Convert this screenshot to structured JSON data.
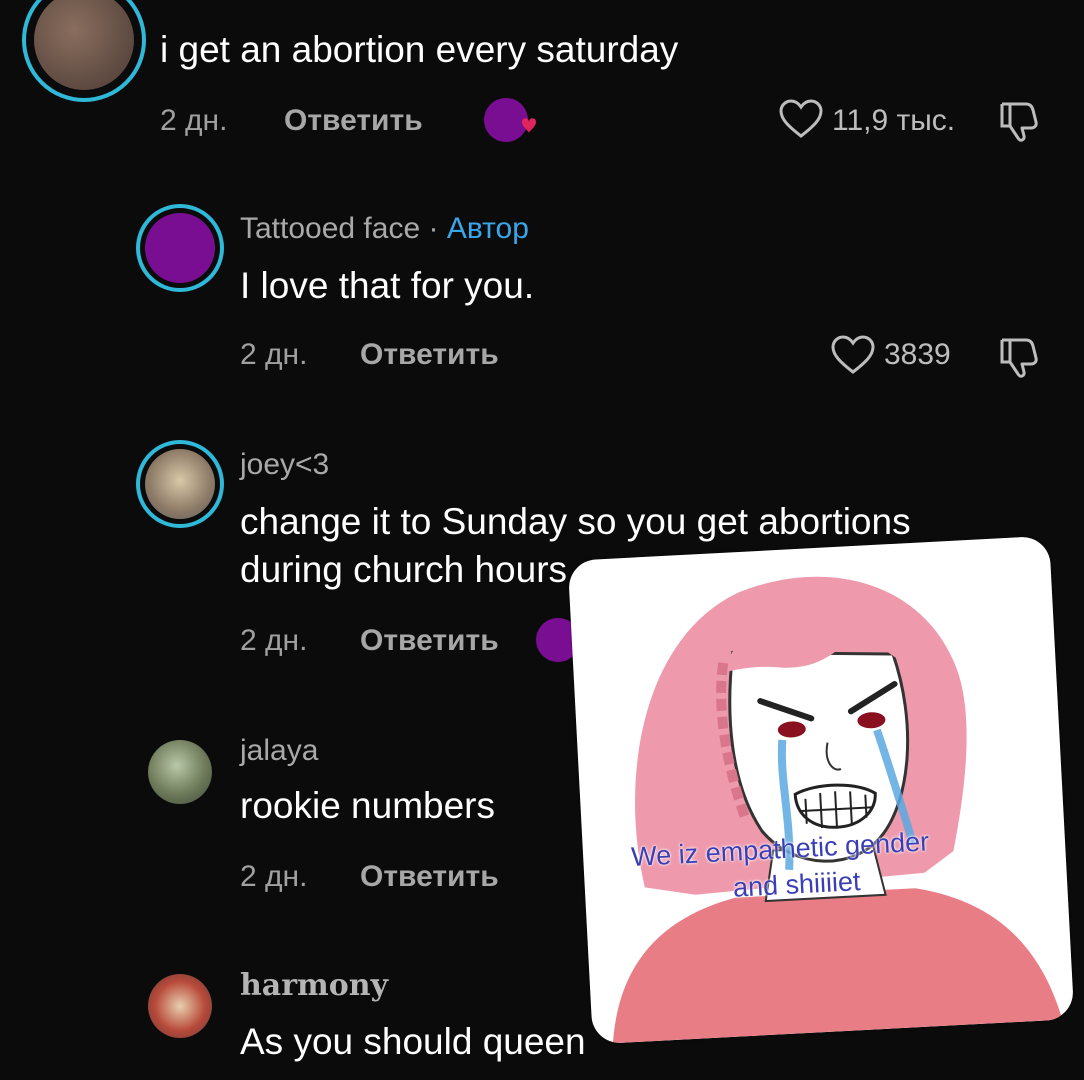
{
  "comments": [
    {
      "text": "i get an abortion every saturday",
      "time": "2 дн.",
      "reply": "Ответить",
      "likes": "11,9 тыс."
    },
    {
      "name": "Tattooed face",
      "separator": " · ",
      "author_badge": "Автор",
      "text": "I love that for you.",
      "time": "2 дн.",
      "reply": "Ответить",
      "likes": "3839"
    },
    {
      "name": "joey<3",
      "text_line1": "change it to Sunday so you get abortions",
      "text_line2": "during church hours",
      "time": "2 дн.",
      "reply": "Ответить"
    },
    {
      "name": "jalaya",
      "text": "rookie numbers",
      "time": "2 дн.",
      "reply": "Ответить"
    },
    {
      "name": "harmony",
      "text": "As you should queen"
    }
  ],
  "sticker": {
    "caption_line1": "We iz empathetic gender",
    "caption_line2": "and shiiiiet"
  },
  "colors": {
    "background": "#0b0b0b",
    "story_ring": "#2fb8d8",
    "author_badge": "#3aa6ea",
    "creator_avatar": "#7a0e92",
    "heart_badge": "#e0245e"
  },
  "icons": [
    "heart-outline-icon",
    "dislike-icon",
    "creator-liked-icon"
  ]
}
